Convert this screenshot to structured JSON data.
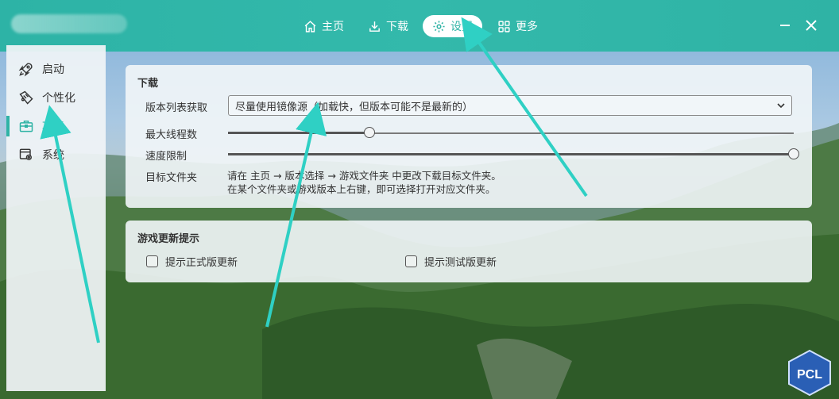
{
  "nav": {
    "home": "主页",
    "download": "下载",
    "settings": "设置",
    "more": "更多"
  },
  "sidebar": {
    "items": [
      {
        "label": "启动",
        "icon": "rocket-icon"
      },
      {
        "label": "个性化",
        "icon": "brush-icon"
      },
      {
        "label": "功能",
        "icon": "toolbox-icon",
        "active": true
      },
      {
        "label": "系统",
        "icon": "system-settings-icon"
      }
    ]
  },
  "download_card": {
    "title": "下载",
    "version_list_label": "版本列表获取",
    "version_list_value": "尽量使用镜像源（加载快，但版本可能不是最新的）",
    "max_threads_label": "最大线程数",
    "max_threads_level": 0.25,
    "speed_limit_label": "速度限制",
    "speed_limit_level": 1.0,
    "target_folder_label": "目标文件夹",
    "target_folder_hint_1": "请在 主页 → 版本选择 → 游戏文件夹 中更改下载目标文件夹。",
    "target_folder_hint_2": "在某个文件夹或游戏版本上右键，即可选择打开对应文件夹。"
  },
  "update_card": {
    "title": "游戏更新提示",
    "release_label": "提示正式版更新",
    "release_checked": false,
    "snapshot_label": "提示测试版更新",
    "snapshot_checked": false
  },
  "brand_badge": "PCL",
  "colors": {
    "accent": "#2fb3a5",
    "arrow": "#2fd0c4"
  }
}
